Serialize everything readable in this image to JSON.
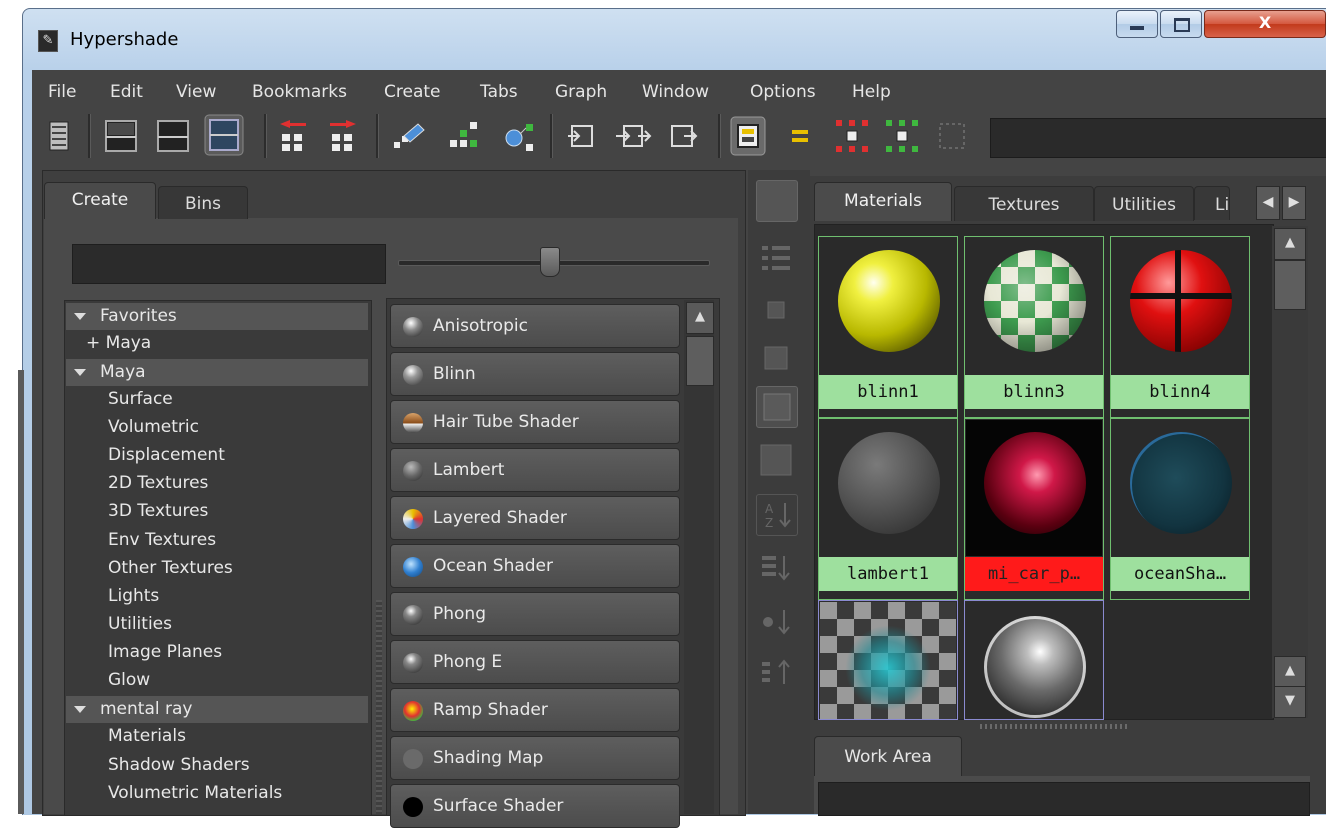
{
  "window": {
    "title": "Hypershade",
    "app_icon": "maya-hypershade-icon",
    "controls": {
      "minimize": "minimize-icon",
      "maximize": "maximize-icon",
      "close": "X"
    }
  },
  "menubar": [
    "File",
    "Edit",
    "View",
    "Bookmarks",
    "Create",
    "Tabs",
    "Graph",
    "Window",
    "Options",
    "Help"
  ],
  "toolbar": {
    "icons": [
      "shelf-icon",
      "layout-top-icon",
      "layout-bottom-icon",
      "layout-split-icon",
      "show-upstream-icon",
      "show-downstream-icon",
      "clear-graph-icon",
      "rearrange-graph-icon",
      "graph-materials-icon",
      "input-connections-icon",
      "input-output-connections-icon",
      "output-connections-icon",
      "toggle-swatches-icon",
      "simple-mode-icon",
      "expand-all-icon",
      "collapse-all-icon",
      "zoom-disabled-icon"
    ],
    "search_value": ""
  },
  "left_panel": {
    "tabs": [
      "Create",
      "Bins"
    ],
    "active_tab": "Create",
    "filter_value": "",
    "tree": [
      {
        "label": "Favorites",
        "type": "header"
      },
      {
        "label": "+ Maya",
        "type": "item"
      },
      {
        "label": "Maya",
        "type": "header"
      },
      {
        "label": "Surface",
        "type": "item"
      },
      {
        "label": "Volumetric",
        "type": "item"
      },
      {
        "label": "Displacement",
        "type": "item"
      },
      {
        "label": "2D Textures",
        "type": "item"
      },
      {
        "label": "3D Textures",
        "type": "item"
      },
      {
        "label": "Env Textures",
        "type": "item"
      },
      {
        "label": "Other Textures",
        "type": "item"
      },
      {
        "label": "Lights",
        "type": "item"
      },
      {
        "label": "Utilities",
        "type": "item"
      },
      {
        "label": "Image Planes",
        "type": "item"
      },
      {
        "label": "Glow",
        "type": "item"
      },
      {
        "label": "mental ray",
        "type": "header"
      },
      {
        "label": "Materials",
        "type": "item"
      },
      {
        "label": "Shadow Shaders",
        "type": "item"
      },
      {
        "label": "Volumetric Materials",
        "type": "item"
      }
    ],
    "shaders": [
      {
        "label": "Anisotropic",
        "icon": "anisotropic-icon"
      },
      {
        "label": "Blinn",
        "icon": "blinn-icon"
      },
      {
        "label": "Hair Tube Shader",
        "icon": "hair-tube-icon"
      },
      {
        "label": "Lambert",
        "icon": "lambert-icon"
      },
      {
        "label": "Layered Shader",
        "icon": "layered-shader-icon"
      },
      {
        "label": "Ocean Shader",
        "icon": "ocean-shader-icon"
      },
      {
        "label": "Phong",
        "icon": "phong-icon"
      },
      {
        "label": "Phong E",
        "icon": "phong-e-icon"
      },
      {
        "label": "Ramp Shader",
        "icon": "ramp-shader-icon"
      },
      {
        "label": "Shading Map",
        "icon": "shading-map-icon"
      },
      {
        "label": "Surface Shader",
        "icon": "surface-shader-icon"
      }
    ]
  },
  "right_panel": {
    "tabs": [
      "Materials",
      "Textures",
      "Utilities",
      "Lig"
    ],
    "active_tab": "Materials",
    "swatches": [
      {
        "name": "blinn1",
        "status": "normal"
      },
      {
        "name": "blinn3",
        "status": "normal"
      },
      {
        "name": "blinn4",
        "status": "normal"
      },
      {
        "name": "lambert1",
        "status": "normal"
      },
      {
        "name": "mi_car_p…",
        "status": "error"
      },
      {
        "name": "oceanSha…",
        "status": "normal"
      },
      {
        "name": "",
        "status": "normal"
      },
      {
        "name": "",
        "status": "normal"
      }
    ],
    "work_area_tab": "Work Area"
  },
  "colors": {
    "panel_bg": "#444444",
    "swatch_label_ok": "#9ee09e",
    "swatch_label_error": "#ff1a1a",
    "titlebar": "#b9d1ea"
  }
}
